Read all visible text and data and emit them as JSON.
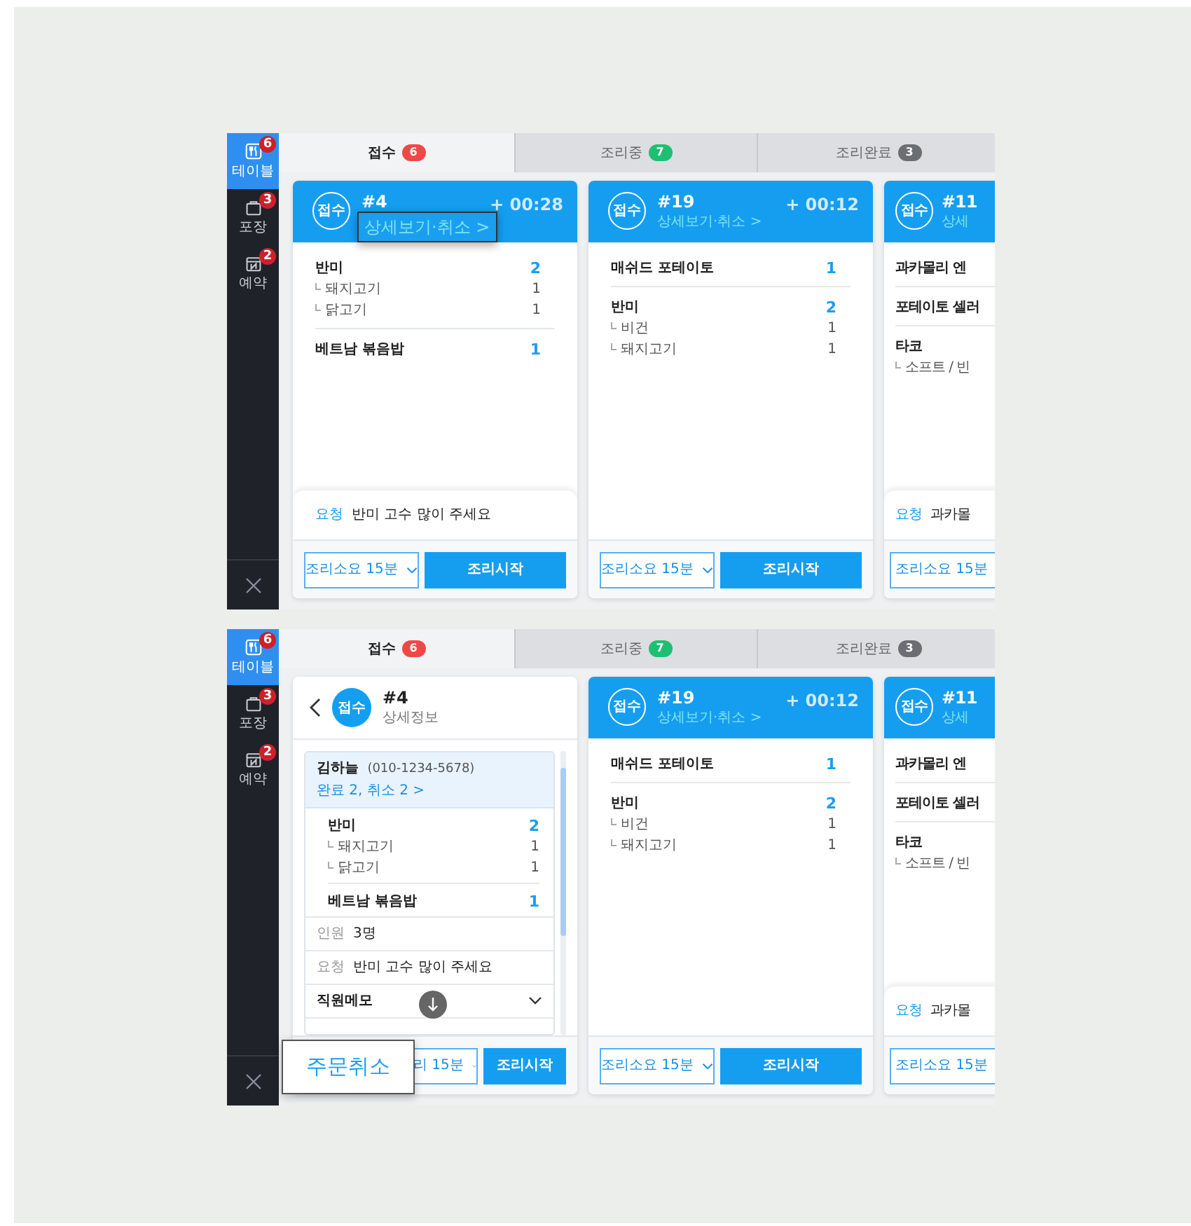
{
  "screens": [
    {
      "sidebar": {
        "items": [
          {
            "kind": "table",
            "label": "테이블",
            "badge": "6",
            "selected": true
          },
          {
            "kind": "bag",
            "label": "포장",
            "badge": "3",
            "selected": false
          },
          {
            "kind": "calendar",
            "label": "예약",
            "badge": "2",
            "selected": false
          }
        ]
      },
      "tabs": [
        {
          "label": "접수",
          "count": "6",
          "color": "#f04848",
          "selected": true
        },
        {
          "label": "조리중",
          "count": "7",
          "color": "#1fbf73",
          "selected": false
        },
        {
          "label": "조리완료",
          "count": "3",
          "color": "#6b6e73",
          "selected": false
        }
      ],
      "cards": [
        {
          "kind": "order",
          "status": "접수",
          "number": "#4",
          "elapsed": "+ 00:28",
          "link": "상세보기·취소 >",
          "link_highlighted": true,
          "items": [
            {
              "name": "반미",
              "qty": "2",
              "options": [
                {
                  "name": "돼지고기",
                  "qty": "1"
                },
                {
                  "name": "닭고기",
                  "qty": "1"
                }
              ]
            },
            {
              "name": "베트남 볶음밥",
              "qty": "1"
            }
          ],
          "request": {
            "label": "요청",
            "text": "반미 고수 많이 주세요"
          },
          "duration": "조리소요 15분",
          "start_button": "조리시작"
        },
        {
          "kind": "order",
          "status": "접수",
          "number": "#19",
          "elapsed": "+ 00:12",
          "link": "상세보기·취소 >",
          "link_highlighted": false,
          "items": [
            {
              "name": "매쉬드 포테이토",
              "qty": "1"
            },
            {
              "name": "반미",
              "qty": "2",
              "options": [
                {
                  "name": "비건",
                  "qty": "1"
                },
                {
                  "name": "돼지고기",
                  "qty": "1"
                }
              ]
            }
          ],
          "duration": "조리소요 15분",
          "start_button": "조리시작"
        },
        {
          "kind": "order",
          "status": "접수",
          "number": "#11",
          "link": "상세",
          "link_highlighted": false,
          "items": [
            {
              "name": "과카몰리 엔"
            },
            {
              "name": "포테이토 셀러"
            },
            {
              "name": "타코",
              "options": [
                {
                  "name": "소프트 / 빈"
                }
              ]
            }
          ],
          "request": {
            "label": "요청",
            "text": "과카몰"
          },
          "duration": "조리소요 15분"
        }
      ]
    },
    {
      "sidebar": {
        "items": [
          {
            "kind": "table",
            "label": "테이블",
            "badge": "6",
            "selected": true
          },
          {
            "kind": "bag",
            "label": "포장",
            "badge": "3",
            "selected": false
          },
          {
            "kind": "calendar",
            "label": "예약",
            "badge": "2",
            "selected": false
          }
        ]
      },
      "tabs": [
        {
          "label": "접수",
          "count": "6",
          "color": "#f04848",
          "selected": true
        },
        {
          "label": "조리중",
          "count": "7",
          "color": "#1fbf73",
          "selected": false
        },
        {
          "label": "조리완료",
          "count": "3",
          "color": "#6b6e73",
          "selected": false
        }
      ],
      "cards": [
        {
          "kind": "detail",
          "status": "접수",
          "number": "#4",
          "subtitle": "상세정보",
          "customer": {
            "name": "김하늘",
            "phone": "(010-1234-5678)",
            "history": "완료 2, 취소 2 >"
          },
          "items": [
            {
              "name": "반미",
              "qty": "2",
              "options": [
                {
                  "name": "돼지고기",
                  "qty": "1"
                },
                {
                  "name": "닭고기",
                  "qty": "1"
                }
              ]
            },
            {
              "name": "베트남 볶음밥",
              "qty": "1"
            }
          ],
          "people": {
            "label": "인원",
            "value": "3명"
          },
          "request": {
            "label": "요청",
            "text": "반미 고수 많이 주세요"
          },
          "memo": "직원메모",
          "cancel_button": "주문취소",
          "duration": "리 15분",
          "start_button": "조리시작"
        },
        {
          "kind": "order",
          "status": "접수",
          "number": "#19",
          "elapsed": "+ 00:12",
          "link": "상세보기·취소 >",
          "link_highlighted": false,
          "items": [
            {
              "name": "매쉬드 포테이토",
              "qty": "1"
            },
            {
              "name": "반미",
              "qty": "2",
              "options": [
                {
                  "name": "비건",
                  "qty": "1"
                },
                {
                  "name": "돼지고기",
                  "qty": "1"
                }
              ]
            }
          ],
          "duration": "조리소요 15분",
          "start_button": "조리시작"
        },
        {
          "kind": "order",
          "status": "접수",
          "number": "#11",
          "link": "상세",
          "link_highlighted": false,
          "items": [
            {
              "name": "과카몰리 엔"
            },
            {
              "name": "포테이토 셀러"
            },
            {
              "name": "타코",
              "options": [
                {
                  "name": "소프트 / 빈"
                }
              ]
            }
          ],
          "request": {
            "label": "요청",
            "text": "과카몰"
          },
          "duration": "조리소요 15분"
        }
      ]
    }
  ]
}
